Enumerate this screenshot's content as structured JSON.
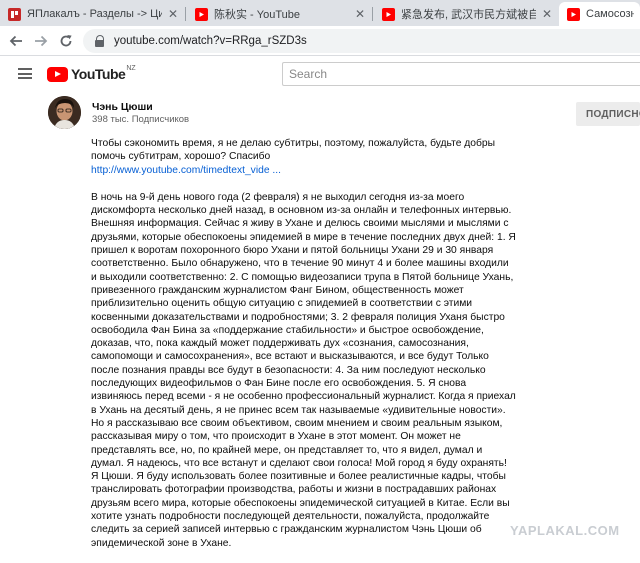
{
  "browser": {
    "tabs": [
      {
        "title": "ЯПлакалъ - Разделы -> Цитиру…",
        "favicon": "yaplakal-icon",
        "color": "#c62828",
        "active": false
      },
      {
        "title": "陈秋实 - YouTube",
        "favicon": "youtube-icon",
        "color": "#ff0000",
        "active": false
      },
      {
        "title": "紧急发布, 武汉市民方斌被自称…",
        "favicon": "youtube-icon",
        "color": "#ff0000",
        "active": false
      },
      {
        "title": "Самосознание",
        "favicon": "youtube-icon",
        "color": "#ff0000",
        "active": true
      }
    ],
    "close_glyph": "✕",
    "url": "youtube.com/watch?v=RRga_rSZD3s"
  },
  "youtube": {
    "logo_text": "YouTube",
    "region": "NZ",
    "search_placeholder": "Search"
  },
  "channel": {
    "name": "Чэнь Цюши",
    "subscribers": "398 тыс. Подписчиков",
    "subscribe_label": "ПОДПИСНО"
  },
  "description": {
    "intro": "Чтобы сэкономить время, я не делаю субтитры, поэтому, пожалуйста, будьте добры помочь субтитрам, хорошо? Спасибо",
    "link": "http://www.youtube.com/timedtext_vide ...",
    "body": "В ночь на 9-й день нового года (2 февраля) я не выходил сегодня из-за моего дискомфорта несколько дней назад, в основном из-за онлайн и телефонных интервью. Внешняя информация. Сейчас я живу в Ухане и делюсь своими мыслями и мыслями с друзьями, которые обеспокоены эпидемией в мире в течение последних двух дней: 1. Я пришел к воротам похоронного бюро Ухани и пятой больницы Ухани 29 и 30 января соответственно. Было обнаружено, что в течение 90 минут 4 и более машины входили и выходили соответственно: 2. С помощью видеозаписи трупа в Пятой больнице Ухань, привезенного гражданским журналистом Фанг Бином, общественность может приблизительно оценить общую ситуацию с эпидемией в соответствии с этими косвенными доказательствами и подробностями; 3. 2 февраля полиция Уханя быстро освободила Фан Бина за «поддержание стабильности» и быстрое освобождение, доказав, что, пока каждый может поддерживать дух «сознания, самосознания, самопомощи и самосохранения», все встают и высказываются, и все будут Только после познания правды все будут в безопасности: 4. За ним последуют несколько последующих видеофильмов о Фан Бине после его освобождения. 5. Я снова извиняюсь перед всеми - я не особенно профессиональный журналист. Когда я приехал в Ухань на десятый день, я не принес всем так называемые «удивительные новости». Но я рассказываю все своим объективом, своим мнением и своим реальным языком, рассказывая миру о том, что происходит в Ухане в этот момент. Он может не представлять все, но, по крайней мере, он представляет то, что я видел, думал и думал. Я надеюсь, что все встанут и сделают свои голоса! Мой город я буду охранять! Я Цюши. Я буду использовать более позитивные и более реалистичные кадры, чтобы транслировать фотографии производства, работы и жизни в пострадавших районах друзьям всего мира, которые обеспокоены эпидемической ситуацией в Китае. Если вы хотите узнать подробности последующей деятельности, пожалуйста, продолжайте следить за серией записей интервью с гражданским журналистом Чэнь Цюши об эпидемической зоне в Ухане."
  },
  "watermark": "YAPLAKAL.COM"
}
